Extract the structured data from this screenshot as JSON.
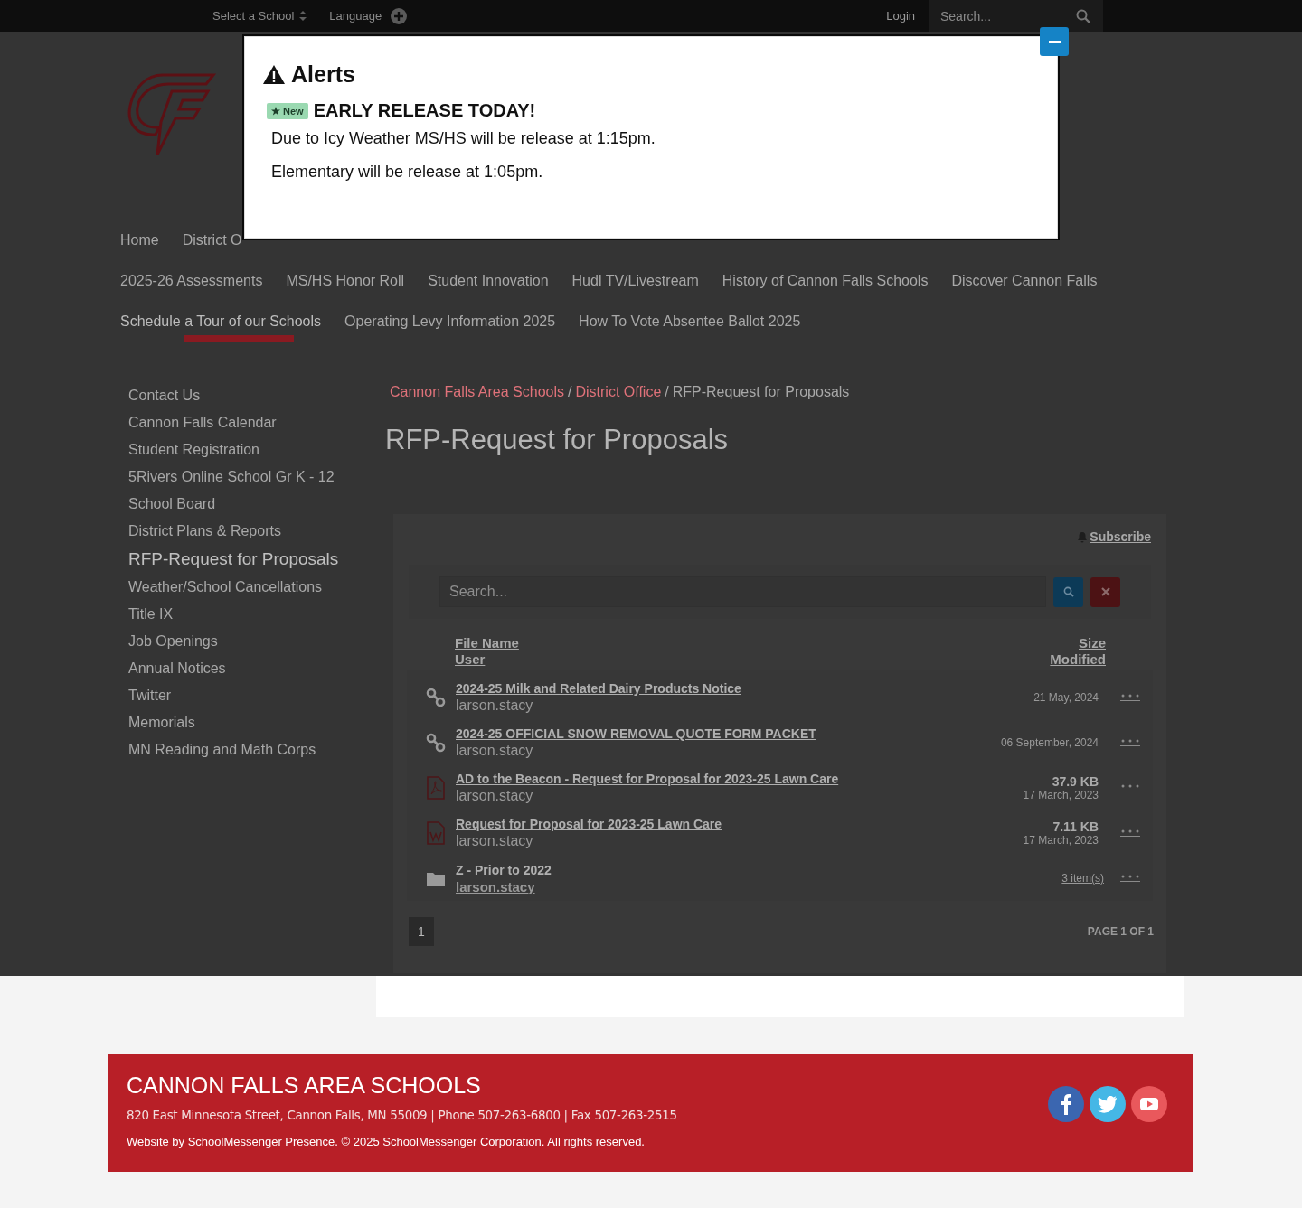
{
  "top_bar": {
    "school_select": "Select a School",
    "language": "Language",
    "login": "Login",
    "search": {
      "placeholder": "Search..."
    }
  },
  "alert": {
    "title": "Alerts",
    "items": [
      {
        "badge": "New",
        "headline": "EARLY RELEASE TODAY!",
        "paragraphs": [
          "Due to Icy Weather MS/HS will be release at 1:15pm.",
          "Elementary will be release at 1:05pm."
        ]
      }
    ]
  },
  "main_nav": {
    "rows": [
      {
        "items": [
          {
            "label": "Home",
            "selected": false
          },
          {
            "label": "District O",
            "selected": false
          }
        ]
      },
      {
        "items": [
          {
            "label": "2025-26 Assessments",
            "selected": false
          },
          {
            "label": "MS/HS Honor Roll",
            "selected": false
          },
          {
            "label": "Student Innovation",
            "selected": false
          },
          {
            "label": "Hudl TV/Livestream",
            "selected": false
          },
          {
            "label": "History of Cannon Falls Schools",
            "selected": false
          },
          {
            "label": "Discover Cannon Falls",
            "selected": false
          }
        ]
      },
      {
        "items": [
          {
            "label": "Schedule a Tour of our Schools",
            "selected": true
          },
          {
            "label": "Operating Levy Information 2025",
            "selected": false
          },
          {
            "label": "How To Vote Absentee Ballot 2025",
            "selected": false
          }
        ]
      }
    ]
  },
  "sidebar": {
    "items": [
      {
        "label": "Contact Us",
        "selected": false
      },
      {
        "label": "Cannon Falls Calendar",
        "selected": false
      },
      {
        "label": "Student Registration",
        "selected": false
      },
      {
        "label": "5Rivers Online School Gr K - 12",
        "selected": false
      },
      {
        "label": "School Board",
        "selected": false
      },
      {
        "label": "District Plans & Reports",
        "selected": false
      },
      {
        "label": "RFP-Request for Proposals",
        "selected": true
      },
      {
        "label": "Weather/School Cancellations",
        "selected": false
      },
      {
        "label": "Title IX",
        "selected": false
      },
      {
        "label": "Job Openings",
        "selected": false
      },
      {
        "label": "Annual Notices",
        "selected": false
      },
      {
        "label": "Twitter",
        "selected": false
      },
      {
        "label": "Memorials",
        "selected": false
      },
      {
        "label": "MN Reading and Math Corps",
        "selected": false
      }
    ]
  },
  "breadcrumb": {
    "separator": "/",
    "items": [
      {
        "label": "Cannon Falls Area Schools",
        "link": true
      },
      {
        "label": "District Office",
        "link": true
      },
      {
        "label": "RFP-Request for Proposals",
        "link": false
      }
    ]
  },
  "page_title": "RFP-Request for Proposals",
  "files": {
    "subscribe": "Subscribe",
    "search": {
      "placeholder": "Search..."
    },
    "columns": {
      "name": "File Name",
      "user": "User",
      "size": "Size",
      "modified": "Modified"
    },
    "rows": [
      {
        "kind": "link",
        "name": "2024-25 Milk and Related Dairy Products Notice",
        "user": "larson.stacy",
        "modified": "21 May, 2024"
      },
      {
        "kind": "link",
        "name": "2024-25 OFFICIAL SNOW REMOVAL QUOTE FORM PACKET",
        "user": "larson.stacy",
        "modified": "06 September, 2024"
      },
      {
        "kind": "pdf",
        "name": "AD to the Beacon - Request for Proposal for 2023-25 Lawn Care",
        "user": "larson.stacy",
        "size": "37.9 KB",
        "modified": "17 March, 2023"
      },
      {
        "kind": "word",
        "name": "Request for Proposal for 2023-25 Lawn Care",
        "user": "larson.stacy",
        "size": "7.11 KB",
        "modified": "17 March, 2023"
      },
      {
        "kind": "folder",
        "name": "Z - Prior to 2022",
        "user": "larson.stacy",
        "items": "3 item(s)"
      }
    ],
    "pagination": {
      "pages": [
        {
          "label": "1",
          "selected": true
        }
      ],
      "summary": "PAGE 1 OF 1"
    }
  },
  "footer": {
    "title": "CANNON FALLS AREA SCHOOLS",
    "address": "820 East Minnesota Street, Cannon Falls, MN 55009 | Phone 507-263-6800 | Fax 507-263-2515",
    "credit_prefix": "Website by ",
    "credit_link": "SchoolMessenger Presence",
    "credit_suffix": ". © 2025 SchoolMessenger Corporation. All rights reserved."
  }
}
